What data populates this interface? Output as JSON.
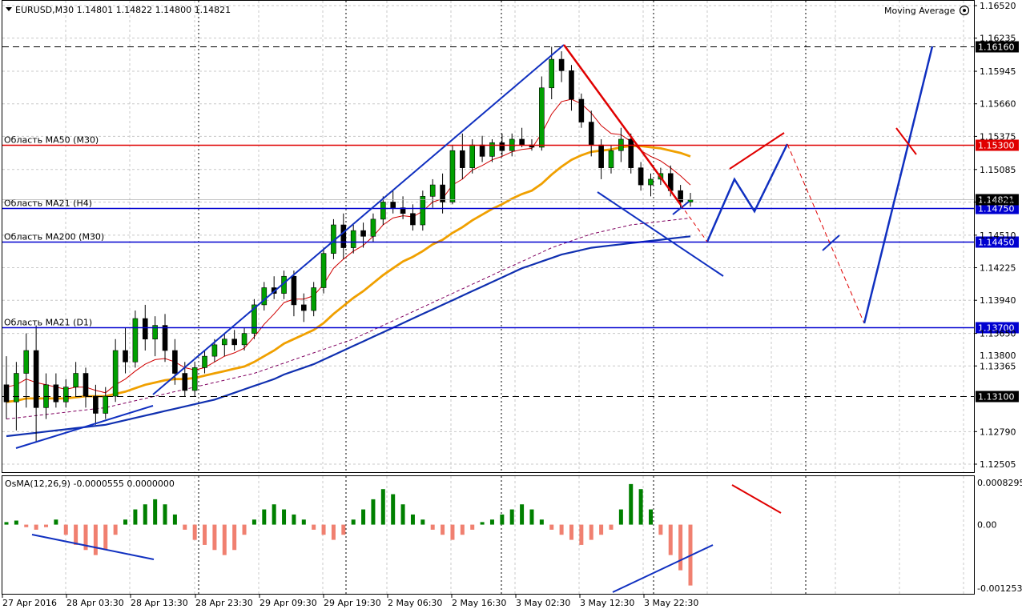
{
  "header": {
    "symbol_line": "EURUSD,M30  1.14801 1.14822 1.14800 1.14821",
    "indicator_name": "Moving Average"
  },
  "osma": {
    "title": "OsMA(12,26,9) -0.0000555 0.0000000",
    "ticks": [
      "0.0008295",
      "0.00",
      "-0.001253"
    ]
  },
  "colors": {
    "up_candle": "#00a000",
    "down_candle": "#000000",
    "ma_fast": "#d00000",
    "ma_mid": "#f0a000",
    "ma_long": "#1030b0",
    "ma_dash": "#800060",
    "hline_blue": "#0000d0",
    "hline_red": "#e00000",
    "osma_up": "#008000",
    "osma_down": "#f08070"
  },
  "chart_data": {
    "type": "candlestick",
    "symbol": "EURUSD",
    "timeframe": "M30",
    "y_ticks": [
      "1.16520",
      "1.16235",
      "1.15945",
      "1.15660",
      "1.15375",
      "1.15085",
      "1.14800",
      "1.14510",
      "1.14225",
      "1.13940",
      "1.13650",
      "1.13365",
      "1.12790",
      "1.12505"
    ],
    "x_ticks": [
      "27 Apr 2016",
      "28 Apr 03:30",
      "28 Apr 13:30",
      "28 Apr 23:30",
      "29 Apr 09:30",
      "29 Apr 19:30",
      "2 May 06:30",
      "2 May 16:30",
      "3 May 02:30",
      "3 May 12:30",
      "3 May 22:30"
    ],
    "levels": [
      {
        "label": "",
        "price_label": "1.16160",
        "price": 1.1616,
        "style": "dashed",
        "color": "black"
      },
      {
        "label": "Область MA50 (M30)",
        "price_label": "1.15300",
        "price": 1.153,
        "style": "solid",
        "color": "red"
      },
      {
        "label": "Область MA21 (H4)",
        "price_label": "1.14750",
        "price": 1.1475,
        "style": "solid",
        "color": "blue"
      },
      {
        "label": "Область MA200 (M30)",
        "price_label": "1.14450",
        "price": 1.1445,
        "style": "solid",
        "color": "blue"
      },
      {
        "label": "Область MA21 (D1)",
        "price_label": "1.13700",
        "price": 1.137,
        "style": "solid",
        "color": "blue"
      },
      {
        "label": "",
        "price_label": "1.13100",
        "price": 1.131,
        "style": "dashed",
        "color": "black"
      }
    ],
    "current_price": {
      "price_label": "1.14821",
      "price": 1.14821
    },
    "partial_tick_label": "1.13800",
    "osma_range": [
      -0.001253,
      0.0008295
    ],
    "candles": [
      {
        "o": 1.132,
        "h": 1.1345,
        "l": 1.129,
        "c": 1.1305
      },
      {
        "o": 1.1305,
        "h": 1.134,
        "l": 1.128,
        "c": 1.133
      },
      {
        "o": 1.133,
        "h": 1.1365,
        "l": 1.13,
        "c": 1.135
      },
      {
        "o": 1.135,
        "h": 1.1372,
        "l": 1.127,
        "c": 1.13
      },
      {
        "o": 1.13,
        "h": 1.133,
        "l": 1.129,
        "c": 1.132
      },
      {
        "o": 1.132,
        "h": 1.133,
        "l": 1.13,
        "c": 1.1305
      },
      {
        "o": 1.1305,
        "h": 1.1325,
        "l": 1.13,
        "c": 1.1318
      },
      {
        "o": 1.1318,
        "h": 1.134,
        "l": 1.131,
        "c": 1.133
      },
      {
        "o": 1.133,
        "h": 1.1335,
        "l": 1.13,
        "c": 1.131
      },
      {
        "o": 1.131,
        "h": 1.132,
        "l": 1.1285,
        "c": 1.1295
      },
      {
        "o": 1.1295,
        "h": 1.1318,
        "l": 1.129,
        "c": 1.131
      },
      {
        "o": 1.131,
        "h": 1.136,
        "l": 1.1305,
        "c": 1.135
      },
      {
        "o": 1.135,
        "h": 1.137,
        "l": 1.133,
        "c": 1.134
      },
      {
        "o": 1.134,
        "h": 1.1385,
        "l": 1.1335,
        "c": 1.1378
      },
      {
        "o": 1.1378,
        "h": 1.139,
        "l": 1.135,
        "c": 1.136
      },
      {
        "o": 1.136,
        "h": 1.138,
        "l": 1.1345,
        "c": 1.1372
      },
      {
        "o": 1.1372,
        "h": 1.1382,
        "l": 1.134,
        "c": 1.135
      },
      {
        "o": 1.135,
        "h": 1.136,
        "l": 1.132,
        "c": 1.133
      },
      {
        "o": 1.133,
        "h": 1.134,
        "l": 1.131,
        "c": 1.1315
      },
      {
        "o": 1.1315,
        "h": 1.134,
        "l": 1.131,
        "c": 1.1335
      },
      {
        "o": 1.1335,
        "h": 1.135,
        "l": 1.133,
        "c": 1.1345
      },
      {
        "o": 1.1345,
        "h": 1.136,
        "l": 1.134,
        "c": 1.1355
      },
      {
        "o": 1.1355,
        "h": 1.1365,
        "l": 1.1345,
        "c": 1.136
      },
      {
        "o": 1.136,
        "h": 1.1368,
        "l": 1.135,
        "c": 1.1355
      },
      {
        "o": 1.1355,
        "h": 1.137,
        "l": 1.135,
        "c": 1.1365
      },
      {
        "o": 1.1365,
        "h": 1.1395,
        "l": 1.136,
        "c": 1.139
      },
      {
        "o": 1.139,
        "h": 1.141,
        "l": 1.1385,
        "c": 1.1405
      },
      {
        "o": 1.1405,
        "h": 1.1415,
        "l": 1.1395,
        "c": 1.14
      },
      {
        "o": 1.14,
        "h": 1.142,
        "l": 1.1395,
        "c": 1.1415
      },
      {
        "o": 1.1415,
        "h": 1.142,
        "l": 1.138,
        "c": 1.139
      },
      {
        "o": 1.139,
        "h": 1.14,
        "l": 1.1375,
        "c": 1.1385
      },
      {
        "o": 1.1385,
        "h": 1.141,
        "l": 1.138,
        "c": 1.1405
      },
      {
        "o": 1.1405,
        "h": 1.144,
        "l": 1.14,
        "c": 1.1435
      },
      {
        "o": 1.1435,
        "h": 1.1465,
        "l": 1.143,
        "c": 1.146
      },
      {
        "o": 1.146,
        "h": 1.147,
        "l": 1.143,
        "c": 1.144
      },
      {
        "o": 1.144,
        "h": 1.146,
        "l": 1.1435,
        "c": 1.1455
      },
      {
        "o": 1.1455,
        "h": 1.1462,
        "l": 1.144,
        "c": 1.145
      },
      {
        "o": 1.145,
        "h": 1.147,
        "l": 1.1445,
        "c": 1.1465
      },
      {
        "o": 1.1465,
        "h": 1.1485,
        "l": 1.146,
        "c": 1.148
      },
      {
        "o": 1.148,
        "h": 1.149,
        "l": 1.147,
        "c": 1.1475
      },
      {
        "o": 1.1475,
        "h": 1.1485,
        "l": 1.1465,
        "c": 1.147
      },
      {
        "o": 1.147,
        "h": 1.1478,
        "l": 1.1455,
        "c": 1.146
      },
      {
        "o": 1.146,
        "h": 1.149,
        "l": 1.1455,
        "c": 1.1485
      },
      {
        "o": 1.1485,
        "h": 1.15,
        "l": 1.1475,
        "c": 1.1495
      },
      {
        "o": 1.1495,
        "h": 1.1505,
        "l": 1.147,
        "c": 1.148
      },
      {
        "o": 1.148,
        "h": 1.153,
        "l": 1.1478,
        "c": 1.1525
      },
      {
        "o": 1.1525,
        "h": 1.154,
        "l": 1.15,
        "c": 1.151
      },
      {
        "o": 1.151,
        "h": 1.1535,
        "l": 1.1505,
        "c": 1.153
      },
      {
        "o": 1.153,
        "h": 1.1538,
        "l": 1.1515,
        "c": 1.152
      },
      {
        "o": 1.152,
        "h": 1.1535,
        "l": 1.1515,
        "c": 1.1532
      },
      {
        "o": 1.1532,
        "h": 1.154,
        "l": 1.152,
        "c": 1.1525
      },
      {
        "o": 1.1525,
        "h": 1.154,
        "l": 1.152,
        "c": 1.1535
      },
      {
        "o": 1.1535,
        "h": 1.1545,
        "l": 1.1528,
        "c": 1.153
      },
      {
        "o": 1.153,
        "h": 1.1535,
        "l": 1.1525,
        "c": 1.1528
      },
      {
        "o": 1.1528,
        "h": 1.159,
        "l": 1.1525,
        "c": 1.158
      },
      {
        "o": 1.158,
        "h": 1.1616,
        "l": 1.157,
        "c": 1.1605
      },
      {
        "o": 1.1605,
        "h": 1.1612,
        "l": 1.1585,
        "c": 1.1595
      },
      {
        "o": 1.1595,
        "h": 1.16,
        "l": 1.156,
        "c": 1.157
      },
      {
        "o": 1.157,
        "h": 1.1575,
        "l": 1.1545,
        "c": 1.155
      },
      {
        "o": 1.155,
        "h": 1.156,
        "l": 1.152,
        "c": 1.153
      },
      {
        "o": 1.153,
        "h": 1.1535,
        "l": 1.15,
        "c": 1.151
      },
      {
        "o": 1.151,
        "h": 1.153,
        "l": 1.1505,
        "c": 1.1525
      },
      {
        "o": 1.1525,
        "h": 1.1545,
        "l": 1.1515,
        "c": 1.1535
      },
      {
        "o": 1.1535,
        "h": 1.154,
        "l": 1.1505,
        "c": 1.151
      },
      {
        "o": 1.151,
        "h": 1.1515,
        "l": 1.149,
        "c": 1.1495
      },
      {
        "o": 1.1495,
        "h": 1.1505,
        "l": 1.1485,
        "c": 1.15
      },
      {
        "o": 1.15,
        "h": 1.151,
        "l": 1.1495,
        "c": 1.1505
      },
      {
        "o": 1.1505,
        "h": 1.1512,
        "l": 1.1485,
        "c": 1.149
      },
      {
        "o": 1.149,
        "h": 1.1495,
        "l": 1.1475,
        "c": 1.148
      },
      {
        "o": 1.148,
        "h": 1.1488,
        "l": 1.1476,
        "c": 1.14821
      }
    ],
    "ma_fast_values": [
      1.1318,
      1.132,
      1.1325,
      1.1322,
      1.132,
      1.1318,
      1.1316,
      1.1318,
      1.1318,
      1.1315,
      1.1313,
      1.132,
      1.1325,
      1.1332,
      1.1338,
      1.1342,
      1.1343,
      1.134,
      1.1335,
      1.1333,
      1.1335,
      1.134,
      1.1345,
      1.1348,
      1.1352,
      1.1362,
      1.1373,
      1.1382,
      1.1392,
      1.1395,
      1.1395,
      1.1398,
      1.1408,
      1.1422,
      1.143,
      1.1437,
      1.1442,
      1.145,
      1.146,
      1.1466,
      1.1468,
      1.1467,
      1.1472,
      1.148,
      1.1483,
      1.1495,
      1.15,
      1.1508,
      1.1512,
      1.1517,
      1.152,
      1.1524,
      1.1526,
      1.1527,
      1.154,
      1.1557,
      1.1568,
      1.157,
      1.1566,
      1.1558,
      1.1547,
      1.154,
      1.1539,
      1.1533,
      1.1525,
      1.152,
      1.1516,
      1.151,
      1.1503,
      1.1495
    ],
    "ma_mid_values": [
      1.1305,
      1.1306,
      1.1308,
      1.1308,
      1.1308,
      1.1308,
      1.1308,
      1.1309,
      1.131,
      1.131,
      1.131,
      1.1312,
      1.1314,
      1.1317,
      1.132,
      1.1322,
      1.1324,
      1.1325,
      1.1325,
      1.1326,
      1.1328,
      1.133,
      1.1332,
      1.1334,
      1.1336,
      1.134,
      1.1345,
      1.135,
      1.1356,
      1.136,
      1.1364,
      1.1368,
      1.1374,
      1.1382,
      1.1389,
      1.1396,
      1.1402,
      1.1409,
      1.1416,
      1.1422,
      1.1428,
      1.1432,
      1.1437,
      1.1443,
      1.1447,
      1.1453,
      1.1458,
      1.1464,
      1.1469,
      1.1474,
      1.1478,
      1.1483,
      1.1487,
      1.149,
      1.1496,
      1.1504,
      1.1511,
      1.1517,
      1.1521,
      1.1524,
      1.1525,
      1.1526,
      1.1528,
      1.1529,
      1.1529,
      1.1528,
      1.1527,
      1.1525,
      1.1523,
      1.152
    ],
    "ma_long_values": [
      1.1275,
      1.1276,
      1.1277,
      1.1278,
      1.1279,
      1.128,
      1.1281,
      1.1282,
      1.1283,
      1.1284,
      1.1285,
      1.1287,
      1.1289,
      1.1291,
      1.1293,
      1.1295,
      1.1297,
      1.1299,
      1.1301,
      1.1303,
      1.1305,
      1.1307,
      1.131,
      1.1313,
      1.1316,
      1.1319,
      1.1322,
      1.1325,
      1.1329,
      1.1332,
      1.1335,
      1.1338,
      1.1342,
      1.1346,
      1.135,
      1.1354,
      1.1358,
      1.1362,
      1.1366,
      1.137,
      1.1374,
      1.1378,
      1.1382,
      1.1386,
      1.139,
      1.1394,
      1.1398,
      1.1402,
      1.1406,
      1.141,
      1.1414,
      1.1418,
      1.1422,
      1.1425,
      1.1428,
      1.1431,
      1.1434,
      1.1436,
      1.1438,
      1.144,
      1.1441,
      1.1442,
      1.1443,
      1.1444,
      1.1445,
      1.1446,
      1.1447,
      1.1448,
      1.1449,
      1.145
    ],
    "ma_dash_values": [
      1.129,
      1.1291,
      1.1292,
      1.1293,
      1.1294,
      1.1295,
      1.1296,
      1.1297,
      1.1298,
      1.1299,
      1.13,
      1.1302,
      1.1304,
      1.1306,
      1.1308,
      1.131,
      1.1312,
      1.1314,
      1.1316,
      1.1318,
      1.132,
      1.1322,
      1.1324,
      1.1326,
      1.1328,
      1.133,
      1.1333,
      1.1336,
      1.1339,
      1.1342,
      1.1345,
      1.1348,
      1.1351,
      1.1354,
      1.1357,
      1.136,
      1.1364,
      1.1368,
      1.1372,
      1.1376,
      1.138,
      1.1384,
      1.1388,
      1.1392,
      1.1396,
      1.14,
      1.1404,
      1.1408,
      1.1412,
      1.1416,
      1.142,
      1.1424,
      1.1428,
      1.1432,
      1.1436,
      1.144,
      1.1443,
      1.1446,
      1.1449,
      1.1452,
      1.1454,
      1.1456,
      1.1458,
      1.146,
      1.1461,
      1.1462,
      1.1463,
      1.1464,
      1.1465,
      1.1466
    ],
    "osma_values": [
      5e-05,
      8e-05,
      -5e-05,
      -0.0001,
      -5e-05,
      0.0001,
      -0.0002,
      -0.0004,
      -0.0005,
      -0.0006,
      -0.0005,
      -0.0002,
      0.0001,
      0.0003,
      0.0004,
      0.0005,
      0.0004,
      0.0002,
      -0.0001,
      -0.0003,
      -0.0004,
      -0.0005,
      -0.0006,
      -0.0005,
      -0.0002,
      0.0001,
      0.0003,
      0.0004,
      0.0003,
      0.0002,
      0.0001,
      -0.0001,
      -0.0002,
      -0.0003,
      -0.0002,
      0.0001,
      0.0003,
      0.0005,
      0.0007,
      0.0006,
      0.0004,
      0.0002,
      0.0001,
      -0.0001,
      -0.0002,
      -0.0003,
      -0.0002,
      -0.0001,
      5e-05,
      0.0001,
      0.0002,
      0.0003,
      0.0004,
      0.0003,
      0.0001,
      -0.0001,
      -0.0002,
      -0.0003,
      -0.0004,
      -0.0003,
      -0.0002,
      -0.0001,
      0.0003,
      0.0008,
      0.0007,
      0.0003,
      -0.0002,
      -0.0006,
      -0.0009,
      -0.0012
    ]
  }
}
